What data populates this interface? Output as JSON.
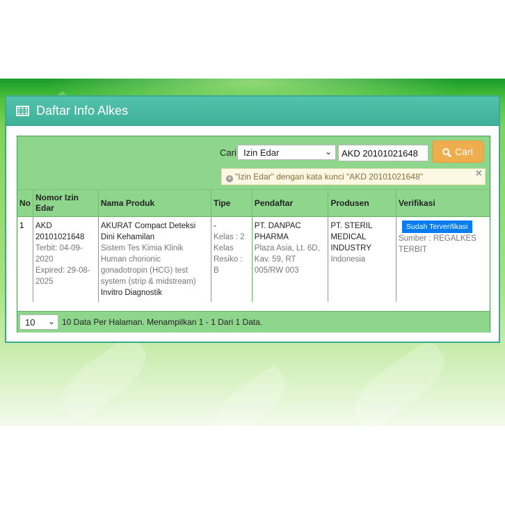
{
  "panel": {
    "title": "Daftar Info Alkes"
  },
  "search": {
    "label": "Cari",
    "field_selected": "Izin Edar",
    "query": "AKD 20101021648",
    "button_label": "Cari",
    "info_message": "\"Izin Edar\" dengan kata kunci \"AKD 20101021648\""
  },
  "table": {
    "headers": [
      "No",
      "Nomor Izin Edar",
      "Nama Produk",
      "Tipe",
      "Pendaftar",
      "Produsen",
      "Verifikasi"
    ],
    "rows": [
      {
        "no": "1",
        "nomor": "AKD 20101021648",
        "terbit": "Terbit: 04-09-2020",
        "expired": "Expired: 29-08-2025",
        "produk_nama": "AKURAT Compact Deteksi Dini Kehamilan",
        "produk_desc": "Sistem Tes Kimia Klinik Human chorionic gonadotropin (HCG) test system (strip & midstream)",
        "produk_kategori": "Invitro Diagnostik",
        "tipe_dash": "-",
        "tipe_kelas": "Kelas : 2 Kelas Resiko : B",
        "pendaftar_nama": "PT. DANPAC PHARMA",
        "pendaftar_alamat": "Plaza Asia, Lt. 6D, Kav. 59, RT 005/RW 003",
        "produsen_nama": "PT. STERIL MEDICAL INDUSTRY",
        "produsen_negara": "Indonesia",
        "verifikasi_badge": "Sudah Terverifikasi",
        "verifikasi_sumber": "Sumber : REGALKES TERBIT"
      }
    ]
  },
  "footer": {
    "per_page": "10",
    "summary": "10 Data Per Halaman. Menampilkan 1 - 1 Dari 1 Data."
  },
  "colors": {
    "header_teal": "#3eaf98",
    "table_green": "#8dd68c",
    "button_orange": "#f0ad4e",
    "badge_blue": "#0a7cf0"
  },
  "icons": [
    "table-grid-icon",
    "search-icon",
    "x-circle-icon",
    "close-icon",
    "chevron-down-icon"
  ]
}
